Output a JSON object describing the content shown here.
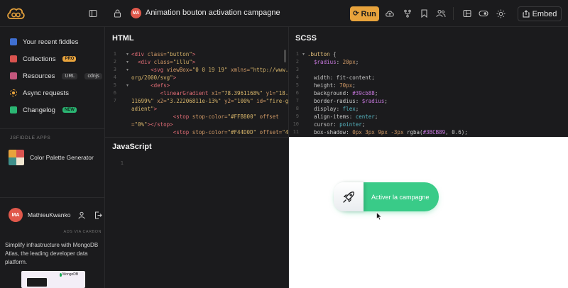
{
  "topbar": {
    "title": "Animation bouton activation campagne",
    "avatar_initials": "MA",
    "run_label": "Run",
    "embed_label": "Embed"
  },
  "sidebar": {
    "items": [
      {
        "label": "Your recent fiddles",
        "icon": "home-icon"
      },
      {
        "label": "Collections",
        "icon": "collections-icon",
        "badge": "PRO"
      },
      {
        "label": "Resources",
        "icon": "resources-icon",
        "extra1": "URL",
        "extra2": "cdnjs"
      },
      {
        "label": "Async requests",
        "icon": "async-icon"
      },
      {
        "label": "Changelog",
        "icon": "changelog-icon",
        "badge": "NEW"
      }
    ],
    "apps_heading": "JSFIDDLE APPS",
    "app_label": "Color Palette Generator",
    "username": "MathieuKwanko",
    "user_initials": "MA",
    "ads_label": "ADS VIA CARBON",
    "ad_text": "Simplify infrastructure with MongoDB Atlas, the leading developer data platform.",
    "ad_logo_text": "MongoDB"
  },
  "panels": {
    "html_title": "HTML",
    "scss_title": "SCSS",
    "js_title": "JavaScript"
  },
  "result": {
    "button_label": "Activer la campagne"
  },
  "colors": {
    "accent": "#e8a33c",
    "button_green": "#39cb88",
    "avatar": "#e0584b"
  }
}
